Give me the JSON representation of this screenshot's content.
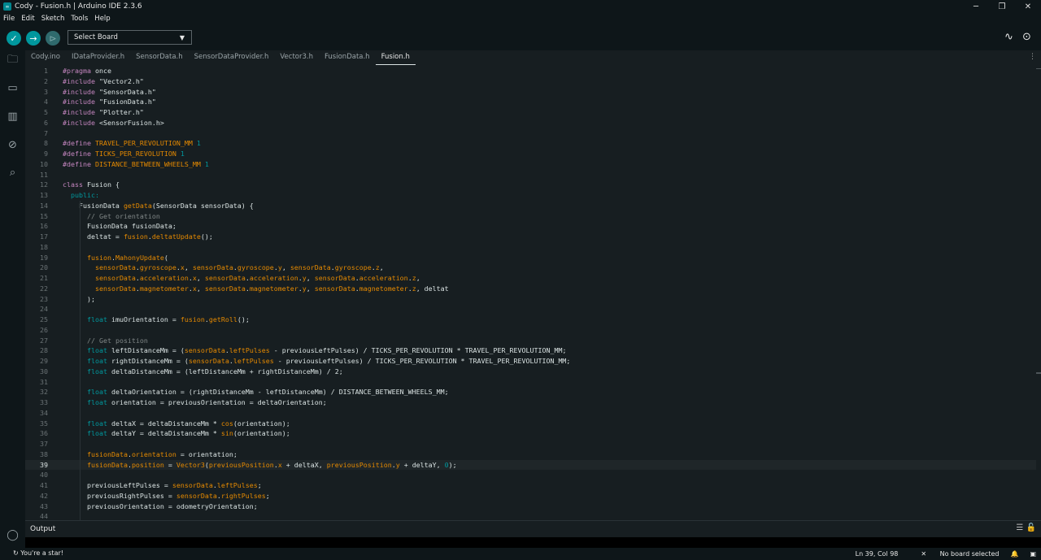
{
  "window": {
    "title": "Cody - Fusion.h | Arduino IDE 2.3.6",
    "app_icon": "arduino-icon",
    "controls": {
      "minimize": "─",
      "maximize": "❐",
      "close": "✕"
    }
  },
  "menu": [
    "File",
    "Edit",
    "Sketch",
    "Tools",
    "Help"
  ],
  "toolbar": {
    "verify_icon": "✓",
    "upload_icon": "→",
    "debug_icon": "⊳",
    "board_select": "Select Board",
    "serial_plotter_icon": "∿",
    "serial_monitor_icon": "⊙"
  },
  "sidebar": [
    {
      "name": "sketchbook-icon",
      "glyph": "🗀"
    },
    {
      "name": "boards-manager-icon",
      "glyph": "▭"
    },
    {
      "name": "library-manager-icon",
      "glyph": "▥"
    },
    {
      "name": "debug-icon",
      "glyph": "⊘"
    },
    {
      "name": "search-icon",
      "glyph": "⌕"
    }
  ],
  "tabs": [
    {
      "label": "Cody.ino",
      "active": false
    },
    {
      "label": "IDataProvider.h",
      "active": false
    },
    {
      "label": "SensorData.h",
      "active": false
    },
    {
      "label": "SensorDataProvider.h",
      "active": false
    },
    {
      "label": "Vector3.h",
      "active": false
    },
    {
      "label": "FusionData.h",
      "active": false
    },
    {
      "label": "Fusion.h",
      "active": true
    }
  ],
  "tabs_more": "⋮",
  "colors": {
    "keyword": "#c586c0",
    "type": "#00979d",
    "macro": "#e68a00",
    "string": "#dae3e3",
    "comment": "#808787",
    "member": "#e68a00",
    "default": "#dae3e3"
  },
  "editor": {
    "current_line": 39,
    "lines": [
      {
        "n": 1,
        "t": [
          {
            "c": "kw",
            "s": "#pragma"
          },
          {
            "s": " once"
          }
        ]
      },
      {
        "n": 2,
        "t": [
          {
            "c": "kw",
            "s": "#include"
          },
          {
            "s": " \"Vector2.h\""
          }
        ]
      },
      {
        "n": 3,
        "t": [
          {
            "c": "kw",
            "s": "#include"
          },
          {
            "s": " \"SensorData.h\""
          }
        ]
      },
      {
        "n": 4,
        "t": [
          {
            "c": "kw",
            "s": "#include"
          },
          {
            "s": " \"FusionData.h\""
          }
        ]
      },
      {
        "n": 5,
        "t": [
          {
            "c": "kw",
            "s": "#include"
          },
          {
            "s": " \"Plotter.h\""
          }
        ]
      },
      {
        "n": 6,
        "t": [
          {
            "c": "kw",
            "s": "#include"
          },
          {
            "s": " <SensorFusion.h>"
          }
        ]
      },
      {
        "n": 7,
        "t": []
      },
      {
        "n": 8,
        "t": [
          {
            "c": "kw",
            "s": "#define"
          },
          {
            "s": " "
          },
          {
            "c": "mc",
            "s": "TRAVEL_PER_REVOLUTION_MM"
          },
          {
            "s": " "
          },
          {
            "c": "ty",
            "s": "1"
          }
        ]
      },
      {
        "n": 9,
        "t": [
          {
            "c": "kw",
            "s": "#define"
          },
          {
            "s": " "
          },
          {
            "c": "mc",
            "s": "TICKS_PER_REVOLUTION"
          },
          {
            "s": " "
          },
          {
            "c": "ty",
            "s": "1"
          }
        ]
      },
      {
        "n": 10,
        "t": [
          {
            "c": "kw",
            "s": "#define"
          },
          {
            "s": " "
          },
          {
            "c": "mc",
            "s": "DISTANCE_BETWEEN_WHEELS_MM"
          },
          {
            "s": " "
          },
          {
            "c": "ty",
            "s": "1"
          }
        ]
      },
      {
        "n": 11,
        "t": []
      },
      {
        "n": 12,
        "t": [
          {
            "c": "kw",
            "s": "class"
          },
          {
            "s": " Fusion {"
          }
        ]
      },
      {
        "n": 13,
        "t": [
          {
            "s": "  "
          },
          {
            "c": "ty",
            "s": "public:"
          }
        ]
      },
      {
        "n": 14,
        "t": [
          {
            "s": "    FusionData "
          },
          {
            "c": "mc",
            "s": "getData"
          },
          {
            "s": "(SensorData sensorData) {"
          }
        ]
      },
      {
        "n": 15,
        "t": [
          {
            "s": "      "
          },
          {
            "c": "cm",
            "s": "// Get orientation"
          }
        ]
      },
      {
        "n": 16,
        "t": [
          {
            "s": "      FusionData fusionData;"
          }
        ]
      },
      {
        "n": 17,
        "t": [
          {
            "s": "      deltat = "
          },
          {
            "c": "mc",
            "s": "fusion"
          },
          {
            "s": "."
          },
          {
            "c": "mc",
            "s": "deltatUpdate"
          },
          {
            "s": "();"
          }
        ]
      },
      {
        "n": 18,
        "t": []
      },
      {
        "n": 19,
        "t": [
          {
            "s": "      "
          },
          {
            "c": "mc",
            "s": "fusion"
          },
          {
            "s": "."
          },
          {
            "c": "mc",
            "s": "MahonyUpdate"
          },
          {
            "s": "("
          }
        ]
      },
      {
        "n": 20,
        "t": [
          {
            "s": "        "
          },
          {
            "c": "mc",
            "s": "sensorData"
          },
          {
            "s": "."
          },
          {
            "c": "mc",
            "s": "gyroscope"
          },
          {
            "s": "."
          },
          {
            "c": "mc",
            "s": "x"
          },
          {
            "s": ", "
          },
          {
            "c": "mc",
            "s": "sensorData"
          },
          {
            "s": "."
          },
          {
            "c": "mc",
            "s": "gyroscope"
          },
          {
            "s": "."
          },
          {
            "c": "mc",
            "s": "y"
          },
          {
            "s": ", "
          },
          {
            "c": "mc",
            "s": "sensorData"
          },
          {
            "s": "."
          },
          {
            "c": "mc",
            "s": "gyroscope"
          },
          {
            "s": "."
          },
          {
            "c": "mc",
            "s": "z"
          },
          {
            "s": ","
          }
        ]
      },
      {
        "n": 21,
        "t": [
          {
            "s": "        "
          },
          {
            "c": "mc",
            "s": "sensorData"
          },
          {
            "s": "."
          },
          {
            "c": "mc",
            "s": "acceleration"
          },
          {
            "s": "."
          },
          {
            "c": "mc",
            "s": "x"
          },
          {
            "s": ", "
          },
          {
            "c": "mc",
            "s": "sensorData"
          },
          {
            "s": "."
          },
          {
            "c": "mc",
            "s": "acceleration"
          },
          {
            "s": "."
          },
          {
            "c": "mc",
            "s": "y"
          },
          {
            "s": ", "
          },
          {
            "c": "mc",
            "s": "sensorData"
          },
          {
            "s": "."
          },
          {
            "c": "mc",
            "s": "acceleration"
          },
          {
            "s": "."
          },
          {
            "c": "mc",
            "s": "z"
          },
          {
            "s": ","
          }
        ]
      },
      {
        "n": 22,
        "t": [
          {
            "s": "        "
          },
          {
            "c": "mc",
            "s": "sensorData"
          },
          {
            "s": "."
          },
          {
            "c": "mc",
            "s": "magnetometer"
          },
          {
            "s": "."
          },
          {
            "c": "mc",
            "s": "x"
          },
          {
            "s": ", "
          },
          {
            "c": "mc",
            "s": "sensorData"
          },
          {
            "s": "."
          },
          {
            "c": "mc",
            "s": "magnetometer"
          },
          {
            "s": "."
          },
          {
            "c": "mc",
            "s": "y"
          },
          {
            "s": ", "
          },
          {
            "c": "mc",
            "s": "sensorData"
          },
          {
            "s": "."
          },
          {
            "c": "mc",
            "s": "magnetometer"
          },
          {
            "s": "."
          },
          {
            "c": "mc",
            "s": "z"
          },
          {
            "s": ", deltat"
          }
        ]
      },
      {
        "n": 23,
        "t": [
          {
            "s": "      );"
          }
        ]
      },
      {
        "n": 24,
        "t": []
      },
      {
        "n": 25,
        "t": [
          {
            "s": "      "
          },
          {
            "c": "ty",
            "s": "float"
          },
          {
            "s": " imuOrientation = "
          },
          {
            "c": "mc",
            "s": "fusion"
          },
          {
            "s": "."
          },
          {
            "c": "mc",
            "s": "getRoll"
          },
          {
            "s": "();"
          }
        ]
      },
      {
        "n": 26,
        "t": []
      },
      {
        "n": 27,
        "t": [
          {
            "s": "      "
          },
          {
            "c": "cm",
            "s": "// Get position"
          }
        ]
      },
      {
        "n": 28,
        "t": [
          {
            "s": "      "
          },
          {
            "c": "ty",
            "s": "float"
          },
          {
            "s": " leftDistanceMm = ("
          },
          {
            "c": "mc",
            "s": "sensorData"
          },
          {
            "s": "."
          },
          {
            "c": "mc",
            "s": "leftPulses"
          },
          {
            "s": " - previousLeftPulses) / TICKS_PER_REVOLUTION * TRAVEL_PER_REVOLUTION_MM;"
          }
        ]
      },
      {
        "n": 29,
        "t": [
          {
            "s": "      "
          },
          {
            "c": "ty",
            "s": "float"
          },
          {
            "s": " rightDistanceMm = ("
          },
          {
            "c": "mc",
            "s": "sensorData"
          },
          {
            "s": "."
          },
          {
            "c": "mc",
            "s": "leftPulses"
          },
          {
            "s": " - previousLeftPulses) / TICKS_PER_REVOLUTION * TRAVEL_PER_REVOLUTION_MM;"
          }
        ]
      },
      {
        "n": 30,
        "t": [
          {
            "s": "      "
          },
          {
            "c": "ty",
            "s": "float"
          },
          {
            "s": " deltaDistanceMm = (leftDistanceMm + rightDistanceMm) / 2;"
          }
        ]
      },
      {
        "n": 31,
        "t": []
      },
      {
        "n": 32,
        "t": [
          {
            "s": "      "
          },
          {
            "c": "ty",
            "s": "float"
          },
          {
            "s": " deltaOrientation = (rightDistanceMm - leftDistanceMm) / DISTANCE_BETWEEN_WHEELS_MM;"
          }
        ]
      },
      {
        "n": 33,
        "t": [
          {
            "s": "      "
          },
          {
            "c": "ty",
            "s": "float"
          },
          {
            "s": " orientation = previousOrientation = deltaOrientation;"
          }
        ]
      },
      {
        "n": 34,
        "t": []
      },
      {
        "n": 35,
        "t": [
          {
            "s": "      "
          },
          {
            "c": "ty",
            "s": "float"
          },
          {
            "s": " deltaX = deltaDistanceMm * "
          },
          {
            "c": "mc",
            "s": "cos"
          },
          {
            "s": "(orientation);"
          }
        ]
      },
      {
        "n": 36,
        "t": [
          {
            "s": "      "
          },
          {
            "c": "ty",
            "s": "float"
          },
          {
            "s": " deltaY = deltaDistanceMm * "
          },
          {
            "c": "mc",
            "s": "sin"
          },
          {
            "s": "(orientation);"
          }
        ]
      },
      {
        "n": 37,
        "t": []
      },
      {
        "n": 38,
        "t": [
          {
            "s": "      "
          },
          {
            "c": "mc",
            "s": "fusionData"
          },
          {
            "s": "."
          },
          {
            "c": "mc",
            "s": "orientation"
          },
          {
            "s": " = orientation;"
          }
        ]
      },
      {
        "n": 39,
        "t": [
          {
            "s": "      "
          },
          {
            "c": "mc",
            "s": "fusionData"
          },
          {
            "s": "."
          },
          {
            "c": "mc",
            "s": "position"
          },
          {
            "s": " = "
          },
          {
            "c": "mc",
            "s": "Vector3"
          },
          {
            "s": "("
          },
          {
            "c": "mc",
            "s": "previousPosition"
          },
          {
            "s": "."
          },
          {
            "c": "mc",
            "s": "x"
          },
          {
            "s": " + deltaX, "
          },
          {
            "c": "mc",
            "s": "previousPosition"
          },
          {
            "s": "."
          },
          {
            "c": "mc",
            "s": "y"
          },
          {
            "s": " + deltaY, "
          },
          {
            "c": "ty",
            "s": "0"
          },
          {
            "s": ");"
          }
        ]
      },
      {
        "n": 40,
        "t": []
      },
      {
        "n": 41,
        "t": [
          {
            "s": "      previousLeftPulses = "
          },
          {
            "c": "mc",
            "s": "sensorData"
          },
          {
            "s": "."
          },
          {
            "c": "mc",
            "s": "leftPulses"
          },
          {
            "s": ";"
          }
        ]
      },
      {
        "n": 42,
        "t": [
          {
            "s": "      previousRightPulses = "
          },
          {
            "c": "mc",
            "s": "sensorData"
          },
          {
            "s": "."
          },
          {
            "c": "mc",
            "s": "rightPulses"
          },
          {
            "s": ";"
          }
        ]
      },
      {
        "n": 43,
        "t": [
          {
            "s": "      previousOrientation = odometryOrientation;"
          }
        ]
      },
      {
        "n": 44,
        "t": []
      }
    ]
  },
  "output": {
    "title": "Output",
    "clear_icon": "☰",
    "lock_icon": "🔓"
  },
  "account_icon": "◯",
  "status": {
    "left": "You're a star!",
    "left_icon": "↻",
    "position": "Ln 39, Col 98",
    "board": "No board selected",
    "board_icon": "✕",
    "notifications_icon": "🔔",
    "panel_icon": "▣"
  }
}
